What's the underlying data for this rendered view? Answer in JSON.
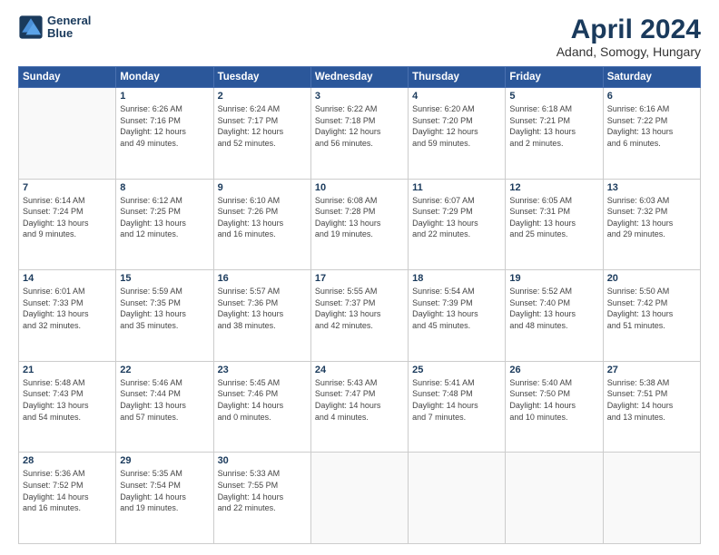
{
  "header": {
    "logo_line1": "General",
    "logo_line2": "Blue",
    "title": "April 2024",
    "subtitle": "Adand, Somogy, Hungary"
  },
  "columns": [
    "Sunday",
    "Monday",
    "Tuesday",
    "Wednesday",
    "Thursday",
    "Friday",
    "Saturday"
  ],
  "weeks": [
    [
      {
        "day": "",
        "info": ""
      },
      {
        "day": "1",
        "info": "Sunrise: 6:26 AM\nSunset: 7:16 PM\nDaylight: 12 hours\nand 49 minutes."
      },
      {
        "day": "2",
        "info": "Sunrise: 6:24 AM\nSunset: 7:17 PM\nDaylight: 12 hours\nand 52 minutes."
      },
      {
        "day": "3",
        "info": "Sunrise: 6:22 AM\nSunset: 7:18 PM\nDaylight: 12 hours\nand 56 minutes."
      },
      {
        "day": "4",
        "info": "Sunrise: 6:20 AM\nSunset: 7:20 PM\nDaylight: 12 hours\nand 59 minutes."
      },
      {
        "day": "5",
        "info": "Sunrise: 6:18 AM\nSunset: 7:21 PM\nDaylight: 13 hours\nand 2 minutes."
      },
      {
        "day": "6",
        "info": "Sunrise: 6:16 AM\nSunset: 7:22 PM\nDaylight: 13 hours\nand 6 minutes."
      }
    ],
    [
      {
        "day": "7",
        "info": "Sunrise: 6:14 AM\nSunset: 7:24 PM\nDaylight: 13 hours\nand 9 minutes."
      },
      {
        "day": "8",
        "info": "Sunrise: 6:12 AM\nSunset: 7:25 PM\nDaylight: 13 hours\nand 12 minutes."
      },
      {
        "day": "9",
        "info": "Sunrise: 6:10 AM\nSunset: 7:26 PM\nDaylight: 13 hours\nand 16 minutes."
      },
      {
        "day": "10",
        "info": "Sunrise: 6:08 AM\nSunset: 7:28 PM\nDaylight: 13 hours\nand 19 minutes."
      },
      {
        "day": "11",
        "info": "Sunrise: 6:07 AM\nSunset: 7:29 PM\nDaylight: 13 hours\nand 22 minutes."
      },
      {
        "day": "12",
        "info": "Sunrise: 6:05 AM\nSunset: 7:31 PM\nDaylight: 13 hours\nand 25 minutes."
      },
      {
        "day": "13",
        "info": "Sunrise: 6:03 AM\nSunset: 7:32 PM\nDaylight: 13 hours\nand 29 minutes."
      }
    ],
    [
      {
        "day": "14",
        "info": "Sunrise: 6:01 AM\nSunset: 7:33 PM\nDaylight: 13 hours\nand 32 minutes."
      },
      {
        "day": "15",
        "info": "Sunrise: 5:59 AM\nSunset: 7:35 PM\nDaylight: 13 hours\nand 35 minutes."
      },
      {
        "day": "16",
        "info": "Sunrise: 5:57 AM\nSunset: 7:36 PM\nDaylight: 13 hours\nand 38 minutes."
      },
      {
        "day": "17",
        "info": "Sunrise: 5:55 AM\nSunset: 7:37 PM\nDaylight: 13 hours\nand 42 minutes."
      },
      {
        "day": "18",
        "info": "Sunrise: 5:54 AM\nSunset: 7:39 PM\nDaylight: 13 hours\nand 45 minutes."
      },
      {
        "day": "19",
        "info": "Sunrise: 5:52 AM\nSunset: 7:40 PM\nDaylight: 13 hours\nand 48 minutes."
      },
      {
        "day": "20",
        "info": "Sunrise: 5:50 AM\nSunset: 7:42 PM\nDaylight: 13 hours\nand 51 minutes."
      }
    ],
    [
      {
        "day": "21",
        "info": "Sunrise: 5:48 AM\nSunset: 7:43 PM\nDaylight: 13 hours\nand 54 minutes."
      },
      {
        "day": "22",
        "info": "Sunrise: 5:46 AM\nSunset: 7:44 PM\nDaylight: 13 hours\nand 57 minutes."
      },
      {
        "day": "23",
        "info": "Sunrise: 5:45 AM\nSunset: 7:46 PM\nDaylight: 14 hours\nand 0 minutes."
      },
      {
        "day": "24",
        "info": "Sunrise: 5:43 AM\nSunset: 7:47 PM\nDaylight: 14 hours\nand 4 minutes."
      },
      {
        "day": "25",
        "info": "Sunrise: 5:41 AM\nSunset: 7:48 PM\nDaylight: 14 hours\nand 7 minutes."
      },
      {
        "day": "26",
        "info": "Sunrise: 5:40 AM\nSunset: 7:50 PM\nDaylight: 14 hours\nand 10 minutes."
      },
      {
        "day": "27",
        "info": "Sunrise: 5:38 AM\nSunset: 7:51 PM\nDaylight: 14 hours\nand 13 minutes."
      }
    ],
    [
      {
        "day": "28",
        "info": "Sunrise: 5:36 AM\nSunset: 7:52 PM\nDaylight: 14 hours\nand 16 minutes."
      },
      {
        "day": "29",
        "info": "Sunrise: 5:35 AM\nSunset: 7:54 PM\nDaylight: 14 hours\nand 19 minutes."
      },
      {
        "day": "30",
        "info": "Sunrise: 5:33 AM\nSunset: 7:55 PM\nDaylight: 14 hours\nand 22 minutes."
      },
      {
        "day": "",
        "info": ""
      },
      {
        "day": "",
        "info": ""
      },
      {
        "day": "",
        "info": ""
      },
      {
        "day": "",
        "info": ""
      }
    ]
  ]
}
